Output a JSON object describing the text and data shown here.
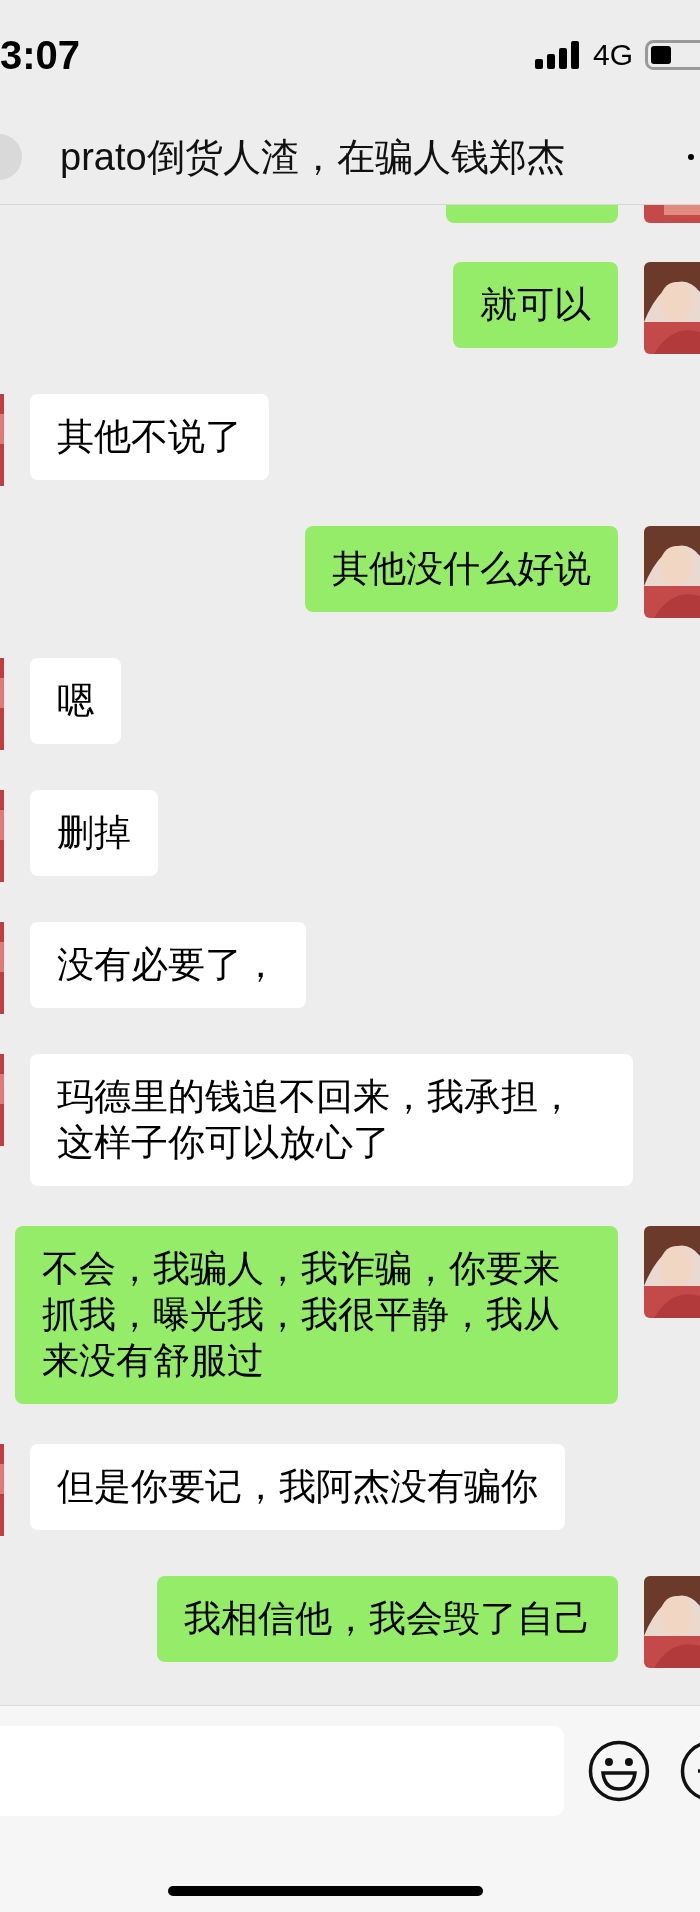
{
  "status_bar": {
    "time": "3:07",
    "network": "4G"
  },
  "header": {
    "title": "prato倒货人渣，在骗人钱郑杰"
  },
  "messages": [
    {
      "kind": "outgoing",
      "text": "就可以"
    },
    {
      "kind": "incoming",
      "text": "其他不说了"
    },
    {
      "kind": "outgoing",
      "text": "其他没什么好说"
    },
    {
      "kind": "incoming",
      "text": "嗯"
    },
    {
      "kind": "incoming",
      "text": "删掉"
    },
    {
      "kind": "incoming",
      "text": "没有必要了，"
    },
    {
      "kind": "incoming",
      "text": "玛德里的钱追不回来，我承担，这样子你可以放心了"
    },
    {
      "kind": "outgoing",
      "text": "不会，我骗人，我诈骗，你要来抓我，曝光我，我很平静，我从来没有舒服过"
    },
    {
      "kind": "incoming",
      "text": "但是你要记，我阿杰没有骗你"
    },
    {
      "kind": "outgoing",
      "text": "我相信他，我会毁了自己"
    }
  ]
}
